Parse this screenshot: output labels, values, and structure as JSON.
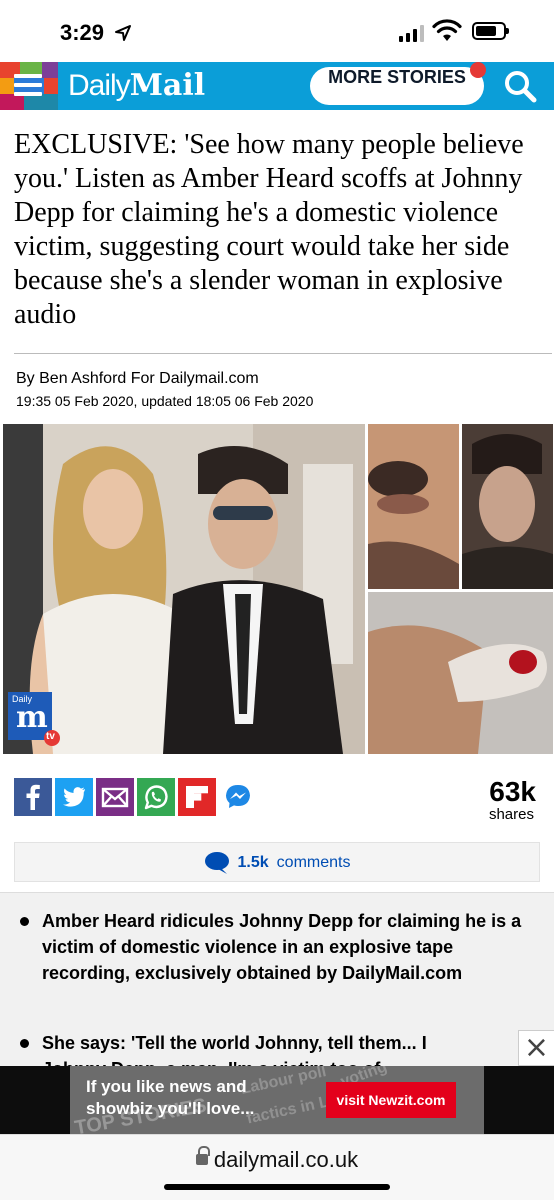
{
  "status_bar": {
    "time": "3:29"
  },
  "header": {
    "brand_light": "Daily",
    "brand_bold": "Mail",
    "more_stories": "MORE STORIES",
    "accent": "#0b9ed8"
  },
  "article": {
    "headline": "EXCLUSIVE: 'See how many people believe you.' Listen as Amber Heard scoffs at Johnny Depp for claiming he's a domestic violence victim, suggesting court would take her side because she's a slender woman in explosive audio",
    "byline": "By Ben Ashford For Dailymail.com",
    "dateline": "19:35 05 Feb 2020, updated 18:05 06 Feb 2020",
    "video_badge_top": "Daily",
    "video_badge_letter": "m",
    "video_badge_tv": "tv"
  },
  "share": {
    "icons": [
      "facebook-icon",
      "twitter-icon",
      "email-icon",
      "whatsapp-icon",
      "flipboard-icon",
      "messenger-icon"
    ],
    "count": "63k",
    "label": "shares"
  },
  "comments": {
    "count": "1.5k",
    "label": "comments"
  },
  "summary": {
    "bullet_1": "Amber Heard ridicules Johnny Depp for claiming he is a victim of domestic violence in an explosive tape recording, exclusively obtained by DailyMail.com",
    "bullet_2_line_1": "She says: 'Tell the world Johnny, tell them... I",
    "bullet_2_line_2": "Johnny Depp, a man. I'm a victim too of"
  },
  "ad": {
    "text_line_1": "If you like news and",
    "text_line_2": "showbiz  you'll love...",
    "button": "visit Newzit.com",
    "bg_word_1": "TOP STORIES",
    "bg_word_2": "Labour poll",
    "bg_word_3": "factics in L",
    "bg_word_4": "voting",
    "close": "×"
  },
  "url_bar": {
    "domain": "dailymail.co.uk"
  }
}
